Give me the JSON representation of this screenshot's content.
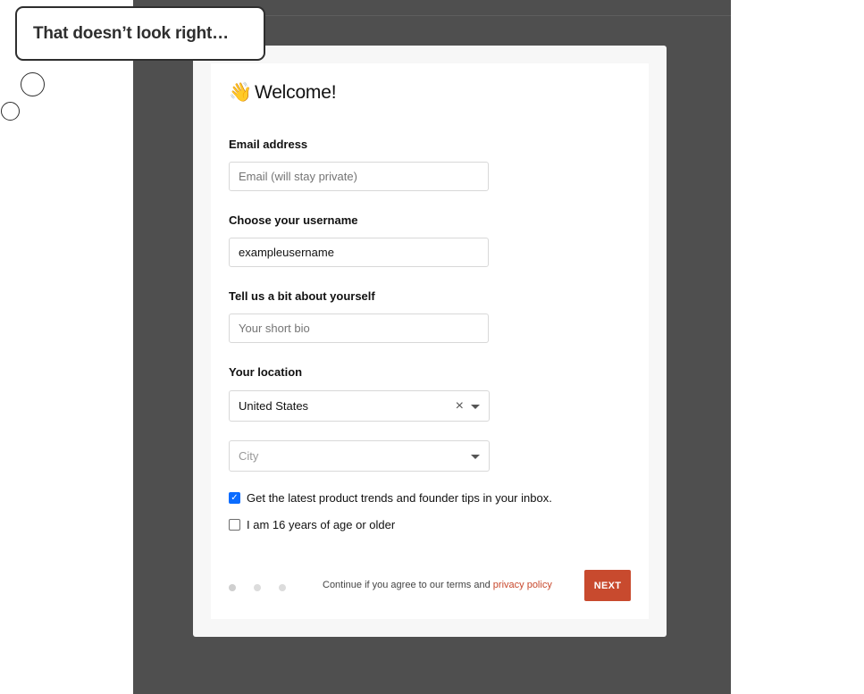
{
  "bubble": {
    "text": "That doesn’t look right…"
  },
  "modal": {
    "title_emoji": "👋",
    "title": "Welcome!",
    "email": {
      "label": "Email address",
      "placeholder": "Email (will stay private)",
      "value": ""
    },
    "username": {
      "label": "Choose your username",
      "value": "exampleusername"
    },
    "bio": {
      "label": "Tell us a bit about yourself",
      "placeholder": "Your short bio",
      "value": ""
    },
    "location": {
      "label": "Your location",
      "country": "United States",
      "clear_symbol": "×",
      "city_placeholder": "City"
    },
    "checkboxes": [
      {
        "label": "Get the latest product trends and founder tips in your inbox.",
        "checked": true
      },
      {
        "label": "I am 16 years of age or older",
        "checked": false
      }
    ],
    "footer": {
      "steps_total": 3,
      "current_step": 1,
      "terms_prefix": "Continue if you agree to our terms and",
      "privacy_link": "privacy policy",
      "next_label": "NEXT"
    }
  },
  "colors": {
    "overlay": "#4f4f4f",
    "accent": "#c84a2e",
    "checkbox_checked": "#0a6cff"
  }
}
